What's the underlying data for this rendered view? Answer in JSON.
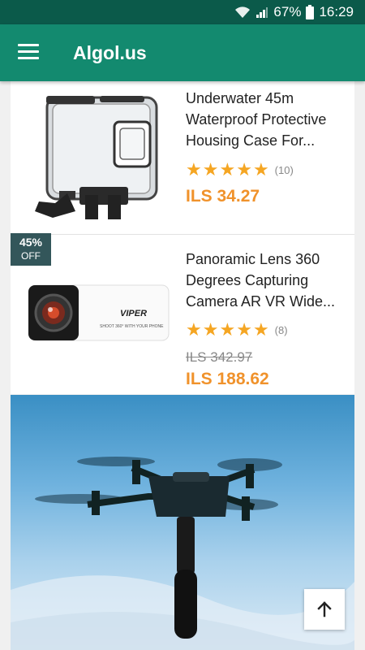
{
  "status_bar": {
    "battery": "67%",
    "time": "16:29"
  },
  "app_bar": {
    "title": "Algol.us"
  },
  "products": [
    {
      "title": "Underwater 45m Waterproof Protective Housing Case For...",
      "rating_count": "(10)",
      "price": "ILS 34.27"
    },
    {
      "title": "Panoramic Lens 360 Degrees Capturing Camera AR VR Wide...",
      "rating_count": "(8)",
      "old_price": "ILS 342.97",
      "price": "ILS 188.62",
      "discount_pct": "45%",
      "discount_label": "OFF",
      "camera_brand": "VIPER",
      "camera_subtext": "SHOOT 360° WITH YOUR PHONE"
    }
  ],
  "colors": {
    "status_bar": "#0b5a4a",
    "app_bar": "#138a6f",
    "price": "#f0922b",
    "star": "#f5a623",
    "badge": "#33565a"
  },
  "icons": {
    "menu": "hamburger-menu-icon",
    "scroll_top": "arrow-up-icon",
    "wifi": "wifi-icon",
    "signal": "signal-icon",
    "battery": "battery-icon"
  }
}
